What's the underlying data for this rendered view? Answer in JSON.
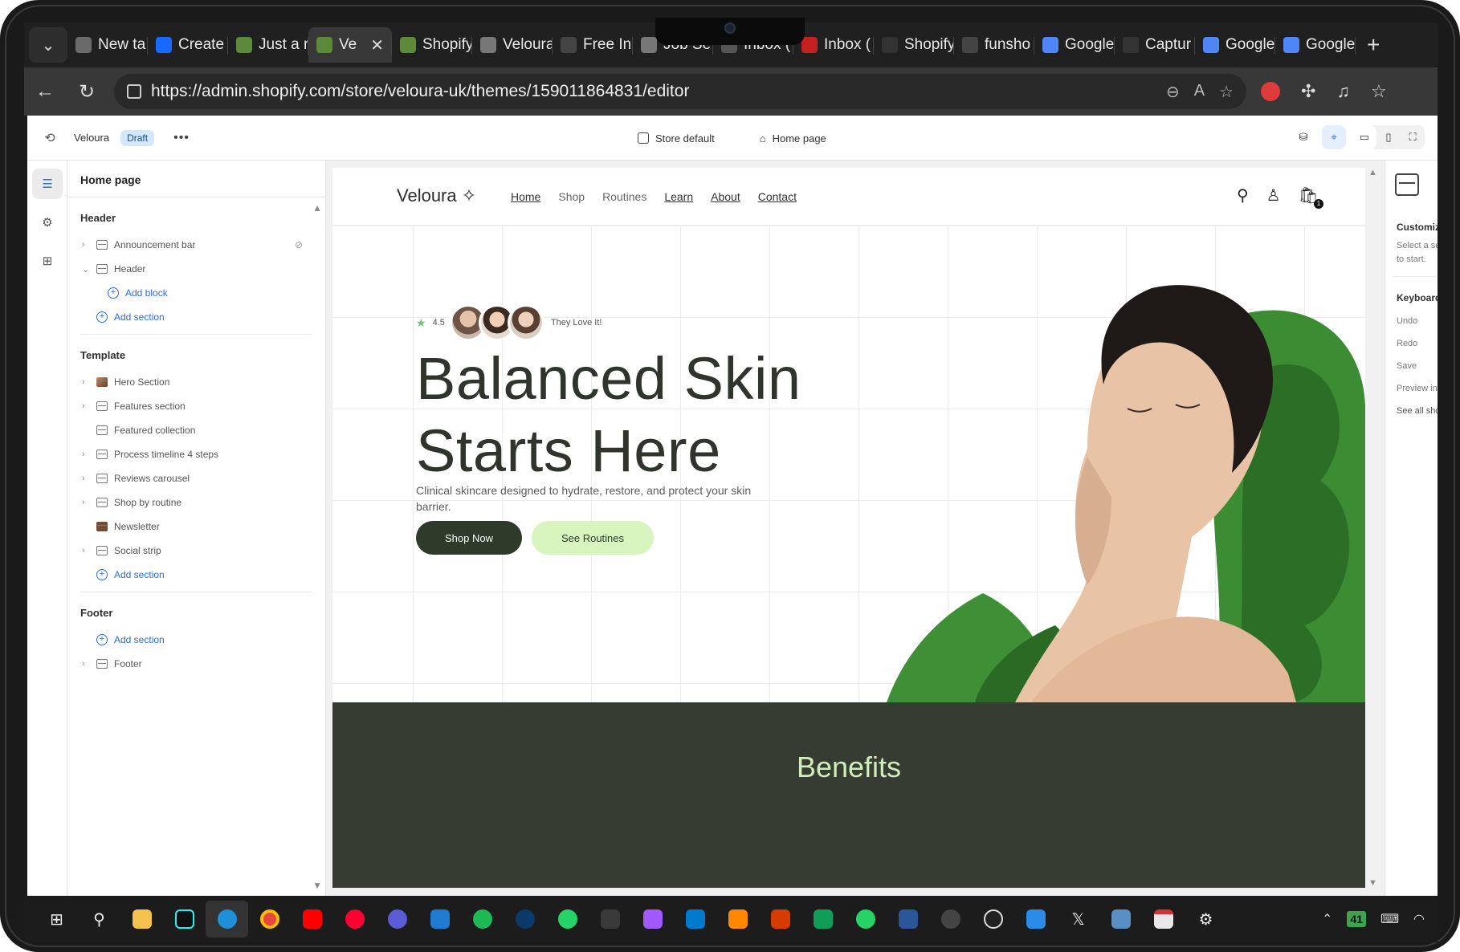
{
  "browser": {
    "tabs": [
      {
        "label": "New ta",
        "fav": "#6a6a6a",
        "active": false
      },
      {
        "label": "Create",
        "fav": "#1769ff",
        "active": false
      },
      {
        "label": "Just a r",
        "fav": "#5c8a3a",
        "active": false
      },
      {
        "label": "Ve",
        "fav": "#5c8a3a",
        "active": true
      },
      {
        "label": "Shopify",
        "fav": "#5c8a3a",
        "active": false
      },
      {
        "label": "Veloura",
        "fav": "#777777",
        "active": false
      },
      {
        "label": "Free In",
        "fav": "#444444",
        "active": false
      },
      {
        "label": "Job Se",
        "fav": "#777777",
        "active": false
      },
      {
        "label": "Inbox (",
        "fav": "#555555",
        "active": false
      },
      {
        "label": "Inbox (",
        "fav": "#c5221f",
        "active": false
      },
      {
        "label": "Shopify",
        "fav": "#333333",
        "active": false
      },
      {
        "label": "funsho",
        "fav": "#444444",
        "active": false
      },
      {
        "label": "Google",
        "fav": "#4f86f7",
        "active": false
      },
      {
        "label": "Captur",
        "fav": "#333333",
        "active": false
      },
      {
        "label": "Google",
        "fav": "#4f86f7",
        "active": false
      },
      {
        "label": "Google",
        "fav": "#4f86f7",
        "active": false
      }
    ],
    "url": "https://admin.shopify.com/store/veloura-uk/themes/159011864831/editor"
  },
  "editor": {
    "store_name": "Veloura",
    "status_badge": "Draft",
    "theme_setting": "Store default",
    "page_select": "Home page",
    "sidebar": {
      "title": "Home page",
      "header_group": {
        "title": "Header",
        "items": [
          {
            "label": "Announcement bar"
          },
          {
            "label": "Header"
          }
        ],
        "add_block": "Add block",
        "add_section": "Add section"
      },
      "template_group": {
        "title": "Template",
        "items": [
          {
            "label": "Hero Section"
          },
          {
            "label": "Features section"
          },
          {
            "label": "Featured collection"
          },
          {
            "label": "Process timeline 4 steps"
          },
          {
            "label": "Reviews carousel"
          },
          {
            "label": "Shop by routine"
          },
          {
            "label": "Newsletter"
          },
          {
            "label": "Social strip"
          }
        ],
        "add_section": "Add section"
      },
      "footer_group": {
        "title": "Footer",
        "add_section": "Add section",
        "items": [
          {
            "label": "Footer"
          }
        ]
      }
    },
    "right_panel": {
      "title": "Customize yo",
      "hint_1": "Select a sectio",
      "hint_2": "to start.",
      "shortcuts_title": "Keyboard sho",
      "shortcuts": [
        "Undo",
        "Redo",
        "Save",
        "Preview inspec",
        "See all shortcu"
      ]
    }
  },
  "site": {
    "logo": "Veloura",
    "logo_mark": "✧",
    "nav": [
      "Home",
      "Shop",
      "Routines",
      "Learn",
      "About",
      "Contact"
    ],
    "cart_count": "1",
    "rating": "4.5",
    "rating_text": "They Love It!",
    "headline_1": "Balanced Skin",
    "headline_2": "Starts Here",
    "subtext": "Clinical skincare designed to hydrate, restore, and protect your skin barrier.",
    "cta_primary": "Shop Now",
    "cta_secondary": "See Routines",
    "next_section_title": "Benefits"
  },
  "taskbar": {
    "tray_badge": "41"
  },
  "colors": {
    "accent_dark": "#2f3a2a",
    "accent_light": "#d8f5c0",
    "benefits_bg": "#363c31",
    "benefits_text": "#cfeeb8",
    "link_blue": "#2c6ecb"
  }
}
